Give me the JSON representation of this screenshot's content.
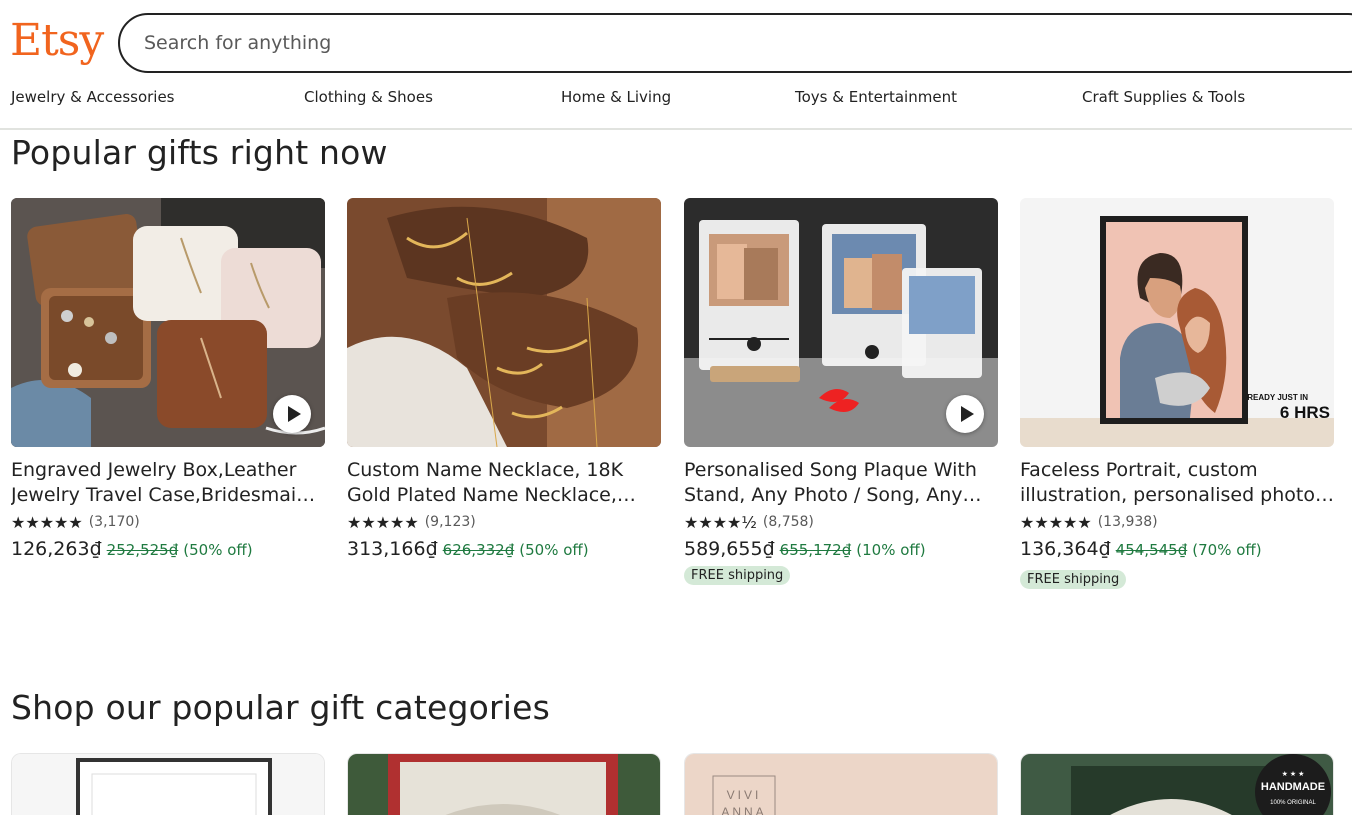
{
  "header": {
    "logo": "Etsy",
    "search_placeholder": "Search for anything",
    "brand_color": "#F1641E"
  },
  "categories_nav": [
    "Jewelry & Accessories",
    "Clothing & Shoes",
    "Home & Living",
    "Toys & Entertainment",
    "Craft Supplies & Tools"
  ],
  "popular": {
    "title": "Popular gifts right now",
    "items": [
      {
        "title": "Engraved Jewelry Box,Leather Jewelry Travel Case,Bridesmaid Gifts",
        "stars": "★★★★★",
        "rating": 5,
        "reviews": "(3,170)",
        "price": "126,263₫",
        "original_price": "252,525₫",
        "discount": "(50% off)",
        "video": true
      },
      {
        "title": "Custom Name Necklace, 18K Gold Plated Name Necklace, Personalized Gift",
        "stars": "★★★★★",
        "rating": 5,
        "reviews": "(9,123)",
        "price": "313,166₫",
        "original_price": "626,332₫",
        "discount": "(50% off)",
        "video": false
      },
      {
        "title": "Personalised Song Plaque With Stand, Any Photo / Song, Any Text",
        "stars": "★★★★½",
        "rating": 4.5,
        "reviews": "(8,758)",
        "price": "589,655₫",
        "original_price": "655,172₫",
        "discount": "(10% off)",
        "shipping": "FREE shipping",
        "video": true
      },
      {
        "title": "Faceless Portrait, custom illustration, personalised photo gift",
        "stars": "★★★★★",
        "rating": 5,
        "reviews": "(13,938)",
        "price": "136,364₫",
        "original_price": "454,545₫",
        "discount": "(70% off)",
        "shipping": "FREE shipping",
        "badge_small": "READY JUST IN",
        "badge_big": "6 HRS",
        "video": false
      }
    ]
  },
  "gift_categories": {
    "title": "Shop our popular gift categories",
    "tiles": [
      {
        "name": "frame"
      },
      {
        "name": "book-art"
      },
      {
        "name": "vivi-anna",
        "text_top": "VIVI",
        "text_bottom": "ANNA"
      },
      {
        "name": "book-handmade",
        "badge": "HANDMADE",
        "badge_sub": "100% ORIGINAL"
      }
    ]
  }
}
